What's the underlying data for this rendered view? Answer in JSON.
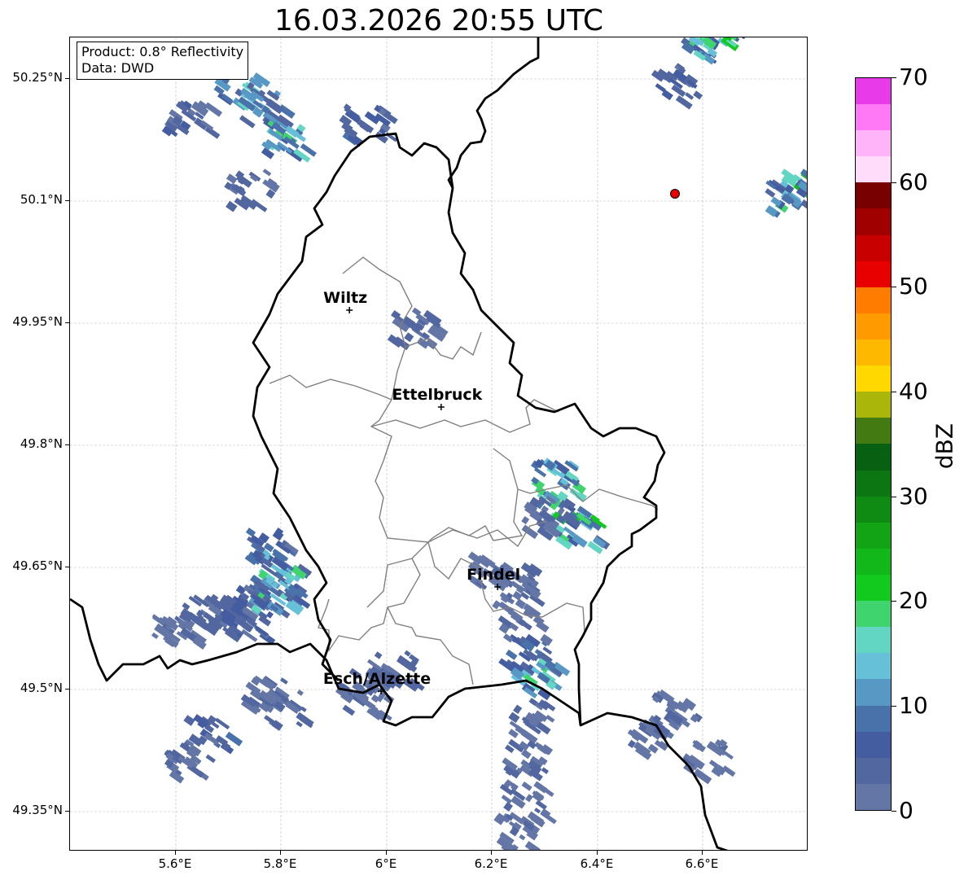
{
  "title": "16.03.2026 20:55 UTC",
  "info_box": {
    "product": "Product: 0.8° Reflectivity",
    "data": "Data: DWD"
  },
  "latitude_ticks": [
    "50.25°N",
    "50.1°N",
    "49.95°N",
    "49.8°N",
    "49.65°N",
    "49.5°N",
    "49.35°N"
  ],
  "longitude_ticks": [
    "5.6°E",
    "5.8°E",
    "6°E",
    "6.2°E",
    "6.4°E",
    "6.6°E"
  ],
  "cities": [
    {
      "name": "Wiltz",
      "lon": 5.93,
      "lat": 49.966
    },
    {
      "name": "Ettelbruck",
      "lon": 6.104,
      "lat": 49.847
    },
    {
      "name": "Findel",
      "lon": 6.211,
      "lat": 49.626
    },
    {
      "name": "Esch/Alzette",
      "lon": 5.99,
      "lat": 49.498
    }
  ],
  "radar_site": {
    "lon": 6.548,
    "lat": 50.11,
    "color": "#e60000"
  },
  "colorbar": {
    "unit": "dBZ",
    "min": 0,
    "max": 70,
    "step": 2.5,
    "tick_labels": [
      "0",
      "10",
      "20",
      "30",
      "40",
      "50",
      "60",
      "70"
    ],
    "colors": [
      "#6376a6",
      "#5266a0",
      "#445ca0",
      "#4a72aa",
      "#5898c4",
      "#66c0d8",
      "#62d6c2",
      "#3fd46e",
      "#12c91e",
      "#12b81a",
      "#12a414",
      "#0f8a12",
      "#0b7612",
      "#086012",
      "#437a12",
      "#aab60a",
      "#ffd800",
      "#ffb800",
      "#ff9a00",
      "#ff7c00",
      "#e80000",
      "#c80000",
      "#a00000",
      "#780000",
      "#ffdcfa",
      "#ffb4fa",
      "#ff78f5",
      "#e83ae8"
    ]
  },
  "map_extent": {
    "lon_min": 5.4,
    "lon_max": 6.8,
    "lat_min": 49.317,
    "lat_max": 50.33
  },
  "echoes": [
    {
      "lon": 5.78,
      "lat": 49.63,
      "dbz": 14
    },
    {
      "lon": 5.75,
      "lat": 49.61,
      "dbz": 8
    },
    {
      "lon": 5.7,
      "lat": 49.6,
      "dbz": 5
    },
    {
      "lon": 5.65,
      "lat": 49.6,
      "dbz": 4
    },
    {
      "lon": 5.6,
      "lat": 49.58,
      "dbz": 3
    },
    {
      "lon": 5.8,
      "lat": 49.66,
      "dbz": 20
    },
    {
      "lon": 5.77,
      "lat": 49.68,
      "dbz": 10
    },
    {
      "lon": 5.79,
      "lat": 49.62,
      "dbz": 18
    },
    {
      "lon": 5.73,
      "lat": 49.59,
      "dbz": 6
    },
    {
      "lon": 5.77,
      "lat": 49.5,
      "dbz": 3
    },
    {
      "lon": 5.8,
      "lat": 49.48,
      "dbz": 4
    },
    {
      "lon": 5.62,
      "lat": 49.42,
      "dbz": 4
    },
    {
      "lon": 5.66,
      "lat": 49.45,
      "dbz": 8
    },
    {
      "lon": 5.97,
      "lat": 49.51,
      "dbz": 4
    },
    {
      "lon": 6.01,
      "lat": 49.53,
      "dbz": 5
    },
    {
      "lon": 5.95,
      "lat": 49.49,
      "dbz": 3
    },
    {
      "lon": 6.25,
      "lat": 49.6,
      "dbz": 4
    },
    {
      "lon": 6.26,
      "lat": 49.55,
      "dbz": 8
    },
    {
      "lon": 6.28,
      "lat": 49.52,
      "dbz": 20
    },
    {
      "lon": 6.27,
      "lat": 49.47,
      "dbz": 4
    },
    {
      "lon": 6.26,
      "lat": 49.42,
      "dbz": 4
    },
    {
      "lon": 6.26,
      "lat": 49.37,
      "dbz": 3
    },
    {
      "lon": 6.24,
      "lat": 49.33,
      "dbz": 3
    },
    {
      "lon": 6.24,
      "lat": 49.64,
      "dbz": 4
    },
    {
      "lon": 6.2,
      "lat": 49.65,
      "dbz": 3
    },
    {
      "lon": 6.33,
      "lat": 49.73,
      "dbz": 20
    },
    {
      "lon": 6.36,
      "lat": 49.7,
      "dbz": 22
    },
    {
      "lon": 6.32,
      "lat": 49.77,
      "dbz": 20
    },
    {
      "lon": 6.3,
      "lat": 49.72,
      "dbz": 5
    },
    {
      "lon": 5.72,
      "lat": 50.24,
      "dbz": 18
    },
    {
      "lon": 5.76,
      "lat": 50.22,
      "dbz": 12
    },
    {
      "lon": 5.62,
      "lat": 50.21,
      "dbz": 6
    },
    {
      "lon": 5.8,
      "lat": 50.18,
      "dbz": 20
    },
    {
      "lon": 5.74,
      "lat": 50.12,
      "dbz": 5
    },
    {
      "lon": 5.96,
      "lat": 50.2,
      "dbz": 8
    },
    {
      "lon": 6.6,
      "lat": 50.3,
      "dbz": 20
    },
    {
      "lon": 6.62,
      "lat": 50.31,
      "dbz": 23
    },
    {
      "lon": 6.55,
      "lat": 50.25,
      "dbz": 8
    },
    {
      "lon": 6.78,
      "lat": 50.12,
      "dbz": 24
    },
    {
      "lon": 6.76,
      "lat": 50.11,
      "dbz": 14
    },
    {
      "lon": 6.05,
      "lat": 49.95,
      "dbz": 5
    },
    {
      "lon": 6.5,
      "lat": 49.45,
      "dbz": 3
    },
    {
      "lon": 6.55,
      "lat": 49.48,
      "dbz": 3
    },
    {
      "lon": 6.6,
      "lat": 49.42,
      "dbz": 3
    }
  ]
}
